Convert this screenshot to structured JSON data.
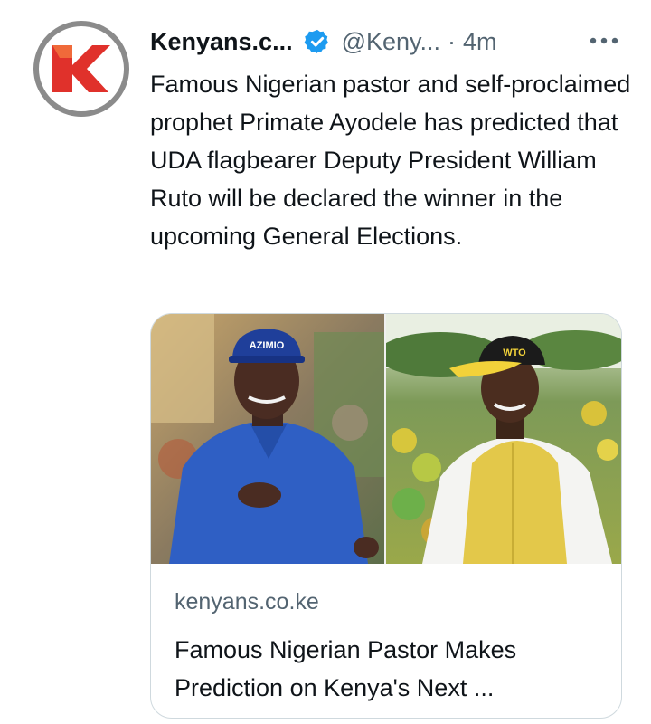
{
  "tweet": {
    "author_name": "Kenyans.c...",
    "handle": "@Keny...",
    "separator": "·",
    "time": "4m",
    "text": "Famous Nigerian pastor and self-proclaimed prophet Primate Ayodele has predicted that UDA flagbearer Deputy President William Ruto will be declared the winner in the upcoming General Elections."
  },
  "card": {
    "domain": "kenyans.co.ke",
    "title": "Famous Nigerian Pastor Makes Prediction on Kenya's Next ...",
    "left_photo_cap_text": "AZIMIO",
    "right_photo_cap_text": "WTO"
  },
  "colors": {
    "verified_badge": "#1d9bf0",
    "secondary_text": "#536471",
    "logo_red": "#e0312b"
  },
  "icons": {
    "verified": "verified-badge-icon",
    "more": "more-options-icon",
    "avatar": "kenyans-logo-avatar"
  }
}
